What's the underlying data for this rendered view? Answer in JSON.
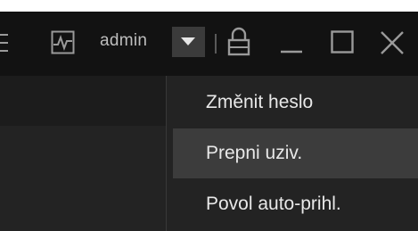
{
  "header": {
    "username": "admin"
  },
  "user_menu": {
    "items": [
      {
        "label": "Změnit heslo"
      },
      {
        "label": "Prepni uziv."
      },
      {
        "label": "Povol auto-prihl."
      }
    ],
    "hovered_index": 1
  },
  "icons": {
    "menu": "hamburger-menu-icon",
    "monitor": "activity-monitor-icon",
    "dropdown": "chevron-down-icon",
    "lock": "lock-icon",
    "minimize": "minimize-icon",
    "maximize": "maximize-icon",
    "close": "close-icon"
  },
  "colors": {
    "titlebar_bg": "#121212",
    "menu_bg": "#232323",
    "menu_hover_bg": "#3c3c3c",
    "icon_fg": "#9a9a9a",
    "text_fg": "#e8e8e8"
  }
}
